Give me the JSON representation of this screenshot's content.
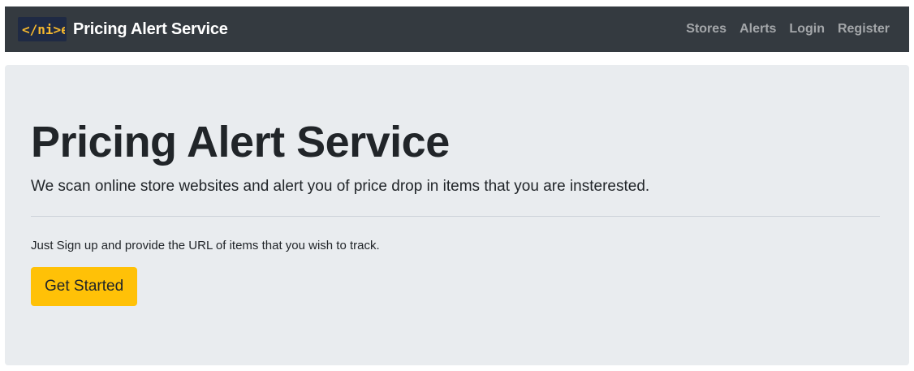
{
  "navbar": {
    "brand": {
      "logo_text": "</ni>e",
      "title": "Pricing Alert Service"
    },
    "links": [
      {
        "label": "Stores"
      },
      {
        "label": "Alerts"
      },
      {
        "label": "Login"
      },
      {
        "label": "Register"
      }
    ]
  },
  "hero": {
    "title": "Pricing Alert Service",
    "lead": "We scan online store websites and alert you of price drop in items that you are insterested.",
    "body": "Just Sign up and provide the URL of items that you wish to track.",
    "cta_label": "Get Started"
  },
  "colors": {
    "navbar_bg": "#343a40",
    "jumbotron_bg": "#e9ecef",
    "cta_bg": "#ffc107",
    "logo_accent": "#f5b82e"
  },
  "icons": {
    "logo": "brand-logo-icon"
  }
}
